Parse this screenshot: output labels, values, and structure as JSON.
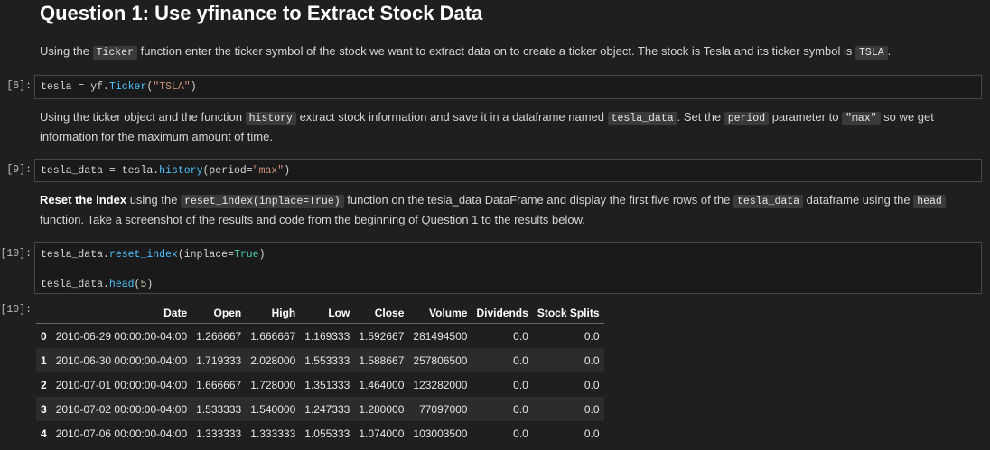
{
  "heading": "Question 1: Use yfinance to Extract Stock Data",
  "md1": {
    "p1": "Using the ",
    "c1": "Ticker",
    "p2": " function enter the ticker symbol of the stock we want to extract data on to create a ticker object. The stock is Tesla and its ticker symbol is ",
    "c2": "TSLA",
    "p3": "."
  },
  "cell1": {
    "prompt": "[6]:",
    "t1": "tesla",
    "t2": " = ",
    "t3": "yf.",
    "t4": "Ticker",
    "t5": "(",
    "t6": "\"TSLA\"",
    "t7": ")"
  },
  "md2": {
    "p1": "Using the ticker object and the function ",
    "c1": "history",
    "p2": " extract stock information and save it in a dataframe named ",
    "c2": "tesla_data",
    "p3": ". Set the ",
    "c3": "period",
    "p4": " parameter to ",
    "c4": "\"max\"",
    "p5": " so we get",
    "p6": "information for the maximum amount of time."
  },
  "cell2": {
    "prompt": "[9]:",
    "t1": "tesla_data",
    "t2": " = ",
    "t3": "tesla.",
    "t4": "history",
    "t5": "(period",
    "t6": "=",
    "t7": "\"max\"",
    "t8": ")"
  },
  "md3": {
    "b1": "Reset the index",
    "p1": " using the ",
    "c1": "reset_index(inplace=True)",
    "p2": " function on the tesla_data DataFrame and display the first five rows of the ",
    "c2": "tesla_data",
    "p3": " dataframe using the ",
    "c3": "head",
    "p4": "function. Take a screenshot of the results and code from the beginning of Question 1 to the results below."
  },
  "cell3": {
    "prompt": "[10]:",
    "l1a": "tesla_data.",
    "l1b": "reset_index",
    "l1c": "(inplace",
    "l1d": "=",
    "l1e": "True",
    "l1f": ")",
    "l2a": "tesla_data.",
    "l2b": "head",
    "l2c": "(",
    "l2d": "5",
    "l2e": ")"
  },
  "output": {
    "prompt": "[10]:",
    "columns": [
      "",
      "Date",
      "Open",
      "High",
      "Low",
      "Close",
      "Volume",
      "Dividends",
      "Stock Splits"
    ],
    "rows": [
      [
        "0",
        "2010-06-29 00:00:00-04:00",
        "1.266667",
        "1.666667",
        "1.169333",
        "1.592667",
        "281494500",
        "0.0",
        "0.0"
      ],
      [
        "1",
        "2010-06-30 00:00:00-04:00",
        "1.719333",
        "2.028000",
        "1.553333",
        "1.588667",
        "257806500",
        "0.0",
        "0.0"
      ],
      [
        "2",
        "2010-07-01 00:00:00-04:00",
        "1.666667",
        "1.728000",
        "1.351333",
        "1.464000",
        "123282000",
        "0.0",
        "0.0"
      ],
      [
        "3",
        "2010-07-02 00:00:00-04:00",
        "1.533333",
        "1.540000",
        "1.247333",
        "1.280000",
        "77097000",
        "0.0",
        "0.0"
      ],
      [
        "4",
        "2010-07-06 00:00:00-04:00",
        "1.333333",
        "1.333333",
        "1.055333",
        "1.074000",
        "103003500",
        "0.0",
        "0.0"
      ]
    ]
  }
}
